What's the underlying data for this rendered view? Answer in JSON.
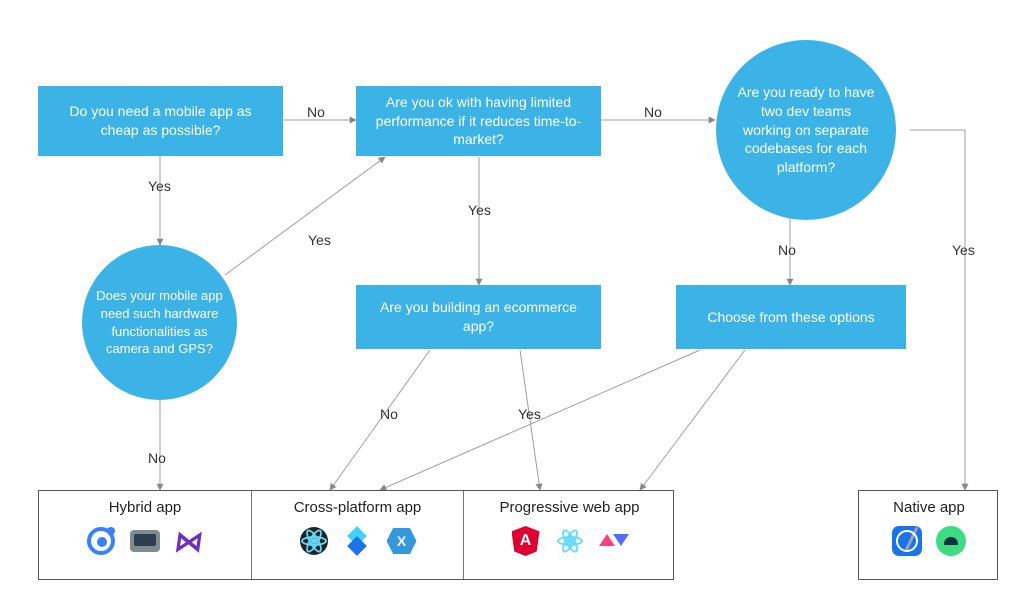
{
  "nodes": {
    "cheap": {
      "text": "Do you need a mobile app as cheap as possible?"
    },
    "perf": {
      "text": "Are you ok with having limited performance if it reduces time-to-market?"
    },
    "teams": {
      "text": "Are you ready to have two dev teams working on separate codebases for each platform?"
    },
    "hw": {
      "text": "Does your mobile app need such hardware functionalities as camera and GPS?"
    },
    "ecom": {
      "text": "Are you building an ecommerce app?"
    },
    "choose": {
      "text": "Choose from these options"
    }
  },
  "labels": {
    "yes": "Yes",
    "no": "No"
  },
  "results": {
    "hybrid": {
      "title": "Hybrid app"
    },
    "cross": {
      "title": "Cross-platform app"
    },
    "pwa": {
      "title": "Progressive web app"
    },
    "native": {
      "title": "Native app"
    }
  },
  "chart_data": {
    "type": "flowchart",
    "nodes": [
      {
        "id": "cheap",
        "shape": "rect",
        "text": "Do you need a mobile app as cheap as possible?"
      },
      {
        "id": "perf",
        "shape": "rect",
        "text": "Are you ok with having limited performance if it reduces time-to-market?"
      },
      {
        "id": "teams",
        "shape": "circle",
        "text": "Are you ready to have two dev teams working on separate codebases for each platform?"
      },
      {
        "id": "hw",
        "shape": "circle",
        "text": "Does your mobile app need such hardware functionalities as camera and GPS?"
      },
      {
        "id": "ecom",
        "shape": "rect",
        "text": "Are you building an ecommerce app?"
      },
      {
        "id": "choose",
        "shape": "rect",
        "text": "Choose from these options"
      },
      {
        "id": "hybrid",
        "shape": "result",
        "text": "Hybrid app",
        "tools": [
          "Ionic",
          "Apache Cordova",
          "Visual Studio"
        ]
      },
      {
        "id": "cross",
        "shape": "result",
        "text": "Cross-platform app",
        "tools": [
          "React Native",
          "Flutter",
          "Xamarin"
        ]
      },
      {
        "id": "pwa",
        "shape": "result",
        "text": "Progressive web app",
        "tools": [
          "Angular",
          "React",
          "Polymer"
        ]
      },
      {
        "id": "native",
        "shape": "result",
        "text": "Native app",
        "tools": [
          "Xcode",
          "Android Studio"
        ]
      }
    ],
    "edges": [
      {
        "from": "cheap",
        "to": "hw",
        "label": "Yes"
      },
      {
        "from": "cheap",
        "to": "perf",
        "label": "No"
      },
      {
        "from": "hw",
        "to": "hybrid",
        "label": "No"
      },
      {
        "from": "hw",
        "to": "perf",
        "label": "Yes"
      },
      {
        "from": "perf",
        "to": "ecom",
        "label": "Yes"
      },
      {
        "from": "perf",
        "to": "teams",
        "label": "No"
      },
      {
        "from": "ecom",
        "to": "cross",
        "label": "No"
      },
      {
        "from": "ecom",
        "to": "pwa",
        "label": "Yes"
      },
      {
        "from": "teams",
        "to": "native",
        "label": "Yes"
      },
      {
        "from": "teams",
        "to": "choose",
        "label": "No"
      },
      {
        "from": "choose",
        "to": "cross",
        "label": ""
      },
      {
        "from": "choose",
        "to": "pwa",
        "label": ""
      }
    ]
  }
}
